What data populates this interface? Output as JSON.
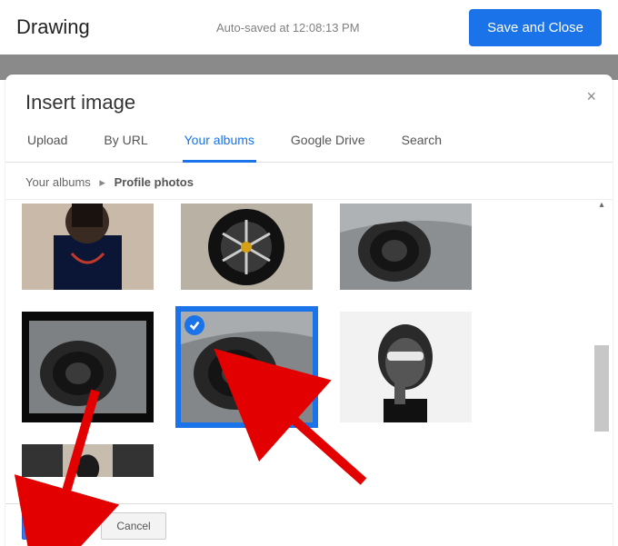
{
  "header": {
    "title": "Drawing",
    "autosave": "Auto-saved at 12:08:13 PM",
    "save_close": "Save and Close"
  },
  "modal": {
    "title": "Insert image",
    "close": "×",
    "tabs": {
      "upload": "Upload",
      "byurl": "By URL",
      "albums": "Your albums",
      "drive": "Google Drive",
      "search": "Search"
    },
    "breadcrumb": {
      "root": "Your albums",
      "current": "Profile photos"
    },
    "thumbnails": [
      {
        "name": "portrait-woman-necklace",
        "selected": false
      },
      {
        "name": "car-wheel",
        "selected": false
      },
      {
        "name": "car-headlight-1",
        "selected": false
      },
      {
        "name": "car-headlight-2",
        "selected": false
      },
      {
        "name": "car-headlight-3",
        "selected": true
      },
      {
        "name": "portrait-woman-glasses-bw",
        "selected": false
      },
      {
        "name": "portrait-partial",
        "selected": false
      }
    ],
    "footer": {
      "select": "Select",
      "cancel": "Cancel"
    }
  }
}
